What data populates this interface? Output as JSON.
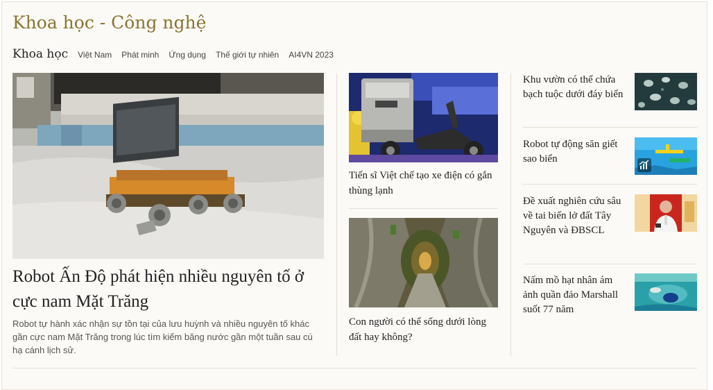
{
  "section": {
    "title": "Khoa học - Công nghệ"
  },
  "nav": {
    "main": "Khoa học",
    "items": [
      "Việt Nam",
      "Phát minh",
      "Ứng dụng",
      "Thế giới tự nhiên",
      "AI4VN 2023"
    ]
  },
  "featured": {
    "title": "Robot Ấn Độ phát hiện nhiều nguyên tố ở cực nam Mặt Trăng",
    "summary": "Robot tự hành xác nhận sự tồn tại của lưu huỳnh và nhiều nguyên tố khác gần cực nam Mặt Trăng trong lúc tìm kiếm băng nước gần một tuần sau cú hạ cánh lịch sử."
  },
  "middle": [
    {
      "title": "Tiến sĩ Việt chế tạo xe điện có gắn thùng lạnh"
    },
    {
      "title": "Con người có thể sống dưới lòng đất hay không?"
    }
  ],
  "right": [
    {
      "title": "Khu vườn có thể chứa bạch tuộc dưới đáy biển"
    },
    {
      "title": "Robot tự động săn giết sao biển",
      "badge_icon": "chart-icon"
    },
    {
      "title": "Đề xuất nghiên cứu sâu về tai biến lở đất Tây Nguyên và ĐBSCL"
    },
    {
      "title": "Nấm mồ hạt nhân ám ảnh quần đảo Marshall suốt 77 năm"
    }
  ],
  "colors": {
    "section_title": "#8a7432",
    "background": "#fcfaf6",
    "divider": "#e4dfd6"
  }
}
